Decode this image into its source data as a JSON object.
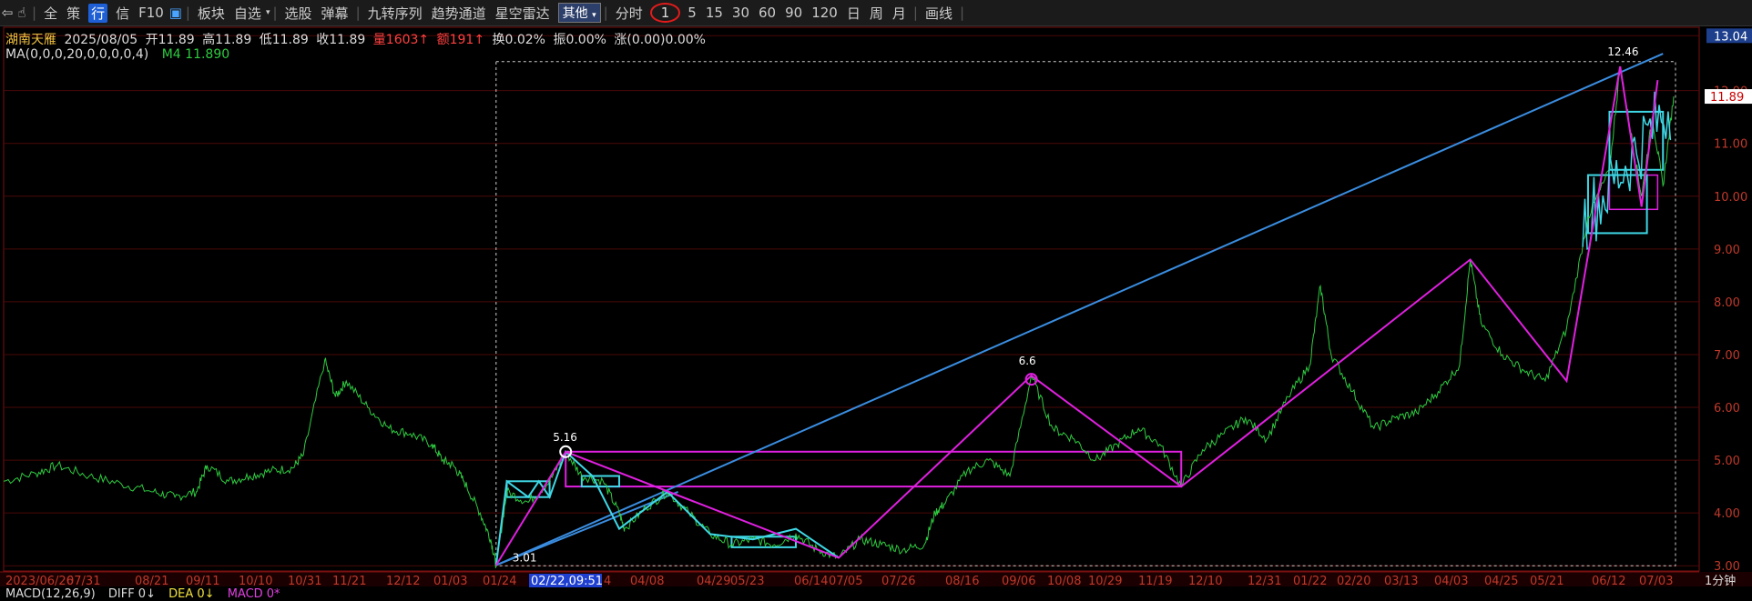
{
  "toolbar": {
    "items": [
      "全",
      "策",
      "行",
      "信",
      "F10",
      "板块",
      "自选",
      "选股",
      "弹幕",
      "九转序列",
      "趋势通道",
      "星空雷达"
    ],
    "dropdown": "其他",
    "periods": [
      "分时",
      "1",
      "5",
      "15",
      "30",
      "60",
      "90",
      "120",
      "日",
      "周",
      "月"
    ],
    "draw": "画线"
  },
  "info": {
    "name": "湖南天雁",
    "date": "2025/08/05",
    "open": "开11.89",
    "high": "高11.89",
    "low": "低11.89",
    "close": "收11.89",
    "volume": "量1603↑",
    "amount": "额191↑",
    "turnover": "换0.02%",
    "amplitude": "振0.00%",
    "change": "涨(0.00)0.00%"
  },
  "ma": {
    "params": "MA(0,0,0,20,0,0,0,0,4)",
    "m4": "M4 11.890"
  },
  "macd": {
    "label": "MACD(12,26,9)",
    "diff": "DIFF 0↓",
    "dea": "DEA 0↓",
    "macd": "MACD 0*"
  },
  "period_label": "1分钟",
  "cursor_label": "02/22,09:51",
  "price_tag": "11.89",
  "colors": {
    "price": "#2ecc40",
    "tick_red": "#c0392b",
    "axis_bg": "#4a0000",
    "magenta": "#e020e0",
    "blue": "#3a8de0",
    "cyan": "#3fd8e6"
  },
  "chart_data": {
    "type": "line",
    "ylim": [
      2.9,
      13.2
    ],
    "yticks": [
      3.0,
      4.0,
      5.0,
      6.0,
      7.0,
      8.0,
      9.0,
      10.0,
      11.0,
      12.0,
      13.04
    ],
    "xticks": [
      "2023/06/26",
      "07/31",
      "08/21",
      "09/11",
      "10/10",
      "10/31",
      "11/21",
      "12/12",
      "01/03",
      "01/24",
      "02/22,09:51",
      "4",
      "04/08",
      "04/29",
      "05/23",
      "06/14",
      "07/05",
      "07/26",
      "08/16",
      "09/06",
      "10/08",
      "10/29",
      "11/19",
      "12/10",
      "12/31",
      "01/22",
      "02/20",
      "03/13",
      "04/03",
      "04/25",
      "05/21",
      "06/12",
      "07/03"
    ],
    "series": [
      {
        "values": [
          [
            0,
            4.6
          ],
          [
            0.03,
            4.75
          ],
          [
            0.05,
            4.9
          ],
          [
            0.08,
            4.7
          ],
          [
            0.11,
            4.55
          ],
          [
            0.14,
            4.4
          ],
          [
            0.16,
            4.3
          ],
          [
            0.18,
            4.4
          ],
          [
            0.19,
            4.9
          ],
          [
            0.21,
            4.6
          ],
          [
            0.23,
            4.7
          ],
          [
            0.25,
            4.8
          ],
          [
            0.27,
            4.85
          ],
          [
            0.28,
            5.1
          ],
          [
            0.3,
            6.9
          ],
          [
            0.31,
            6.2
          ],
          [
            0.32,
            6.5
          ],
          [
            0.34,
            6.0
          ],
          [
            0.36,
            5.6
          ],
          [
            0.38,
            5.5
          ],
          [
            0.4,
            5.3
          ],
          [
            0.41,
            5.0
          ],
          [
            0.42,
            4.9
          ],
          [
            0.43,
            4.6
          ],
          [
            0.445,
            4.0
          ],
          [
            0.455,
            3.5
          ],
          [
            0.46,
            3.01
          ],
          [
            0.47,
            4.4
          ],
          [
            0.49,
            4.2
          ],
          [
            0.51,
            4.6
          ],
          [
            0.525,
            5.16
          ],
          [
            0.54,
            4.7
          ],
          [
            0.56,
            4.6
          ],
          [
            0.575,
            4.0
          ],
          [
            0.58,
            3.7
          ],
          [
            0.6,
            4.1
          ],
          [
            0.62,
            4.4
          ],
          [
            0.64,
            4.0
          ],
          [
            0.66,
            3.6
          ],
          [
            0.68,
            3.4
          ],
          [
            0.7,
            3.5
          ],
          [
            0.72,
            3.4
          ],
          [
            0.74,
            3.6
          ],
          [
            0.76,
            3.3
          ],
          [
            0.78,
            3.15
          ],
          [
            0.8,
            3.5
          ],
          [
            0.82,
            3.4
          ],
          [
            0.84,
            3.3
          ],
          [
            0.86,
            3.4
          ],
          [
            0.87,
            4.0
          ],
          [
            0.88,
            4.2
          ],
          [
            0.9,
            4.8
          ],
          [
            0.92,
            5.0
          ],
          [
            0.94,
            4.7
          ],
          [
            0.96,
            6.6
          ],
          [
            0.98,
            5.6
          ],
          [
            1.0,
            5.4
          ],
          [
            1.02,
            5.0
          ],
          [
            1.04,
            5.3
          ],
          [
            1.06,
            5.6
          ],
          [
            1.08,
            5.3
          ],
          [
            1.1,
            4.5
          ],
          [
            1.12,
            5.2
          ],
          [
            1.14,
            5.5
          ],
          [
            1.16,
            5.8
          ],
          [
            1.18,
            5.4
          ],
          [
            1.2,
            6.2
          ],
          [
            1.22,
            6.8
          ],
          [
            1.23,
            8.3
          ],
          [
            1.24,
            7.0
          ],
          [
            1.26,
            6.3
          ],
          [
            1.28,
            5.6
          ],
          [
            1.3,
            5.8
          ],
          [
            1.32,
            5.9
          ],
          [
            1.34,
            6.3
          ],
          [
            1.36,
            6.8
          ],
          [
            1.37,
            8.8
          ],
          [
            1.38,
            7.6
          ],
          [
            1.4,
            7.0
          ],
          [
            1.42,
            6.7
          ],
          [
            1.44,
            6.5
          ],
          [
            1.46,
            7.5
          ],
          [
            1.48,
            9.6
          ],
          [
            1.5,
            10.5
          ],
          [
            1.51,
            12.46
          ],
          [
            1.52,
            11.2
          ],
          [
            1.53,
            10.0
          ],
          [
            1.54,
            11.5
          ],
          [
            1.55,
            10.2
          ],
          [
            1.56,
            11.89
          ]
        ]
      }
    ],
    "annotations": [
      {
        "label": "3.01",
        "x": 0.46,
        "y": 3.01
      },
      {
        "label": "5.16",
        "x": 0.525,
        "y": 5.16
      },
      {
        "label": "6.6",
        "x": 0.96,
        "y": 6.6
      },
      {
        "label": "12.46",
        "x": 1.51,
        "y": 12.46
      }
    ]
  }
}
